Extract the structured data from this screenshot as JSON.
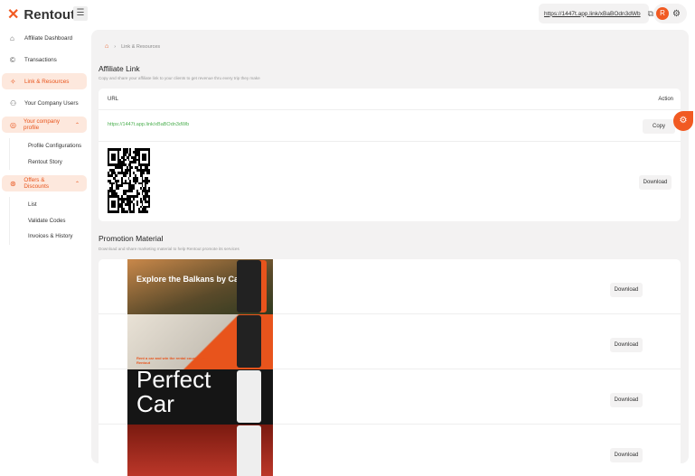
{
  "app": {
    "name": "Rentout",
    "top_link": "https://1447t.app.link/xBaBOdn3dWb",
    "avatar_initial": "R"
  },
  "sidebar": {
    "items": [
      {
        "label": "Affiliate Dashboard",
        "icon": "home-icon"
      },
      {
        "label": "Transactions",
        "icon": "currency-icon"
      },
      {
        "label": "Link & Resources",
        "icon": "sparkle-icon",
        "active": true
      },
      {
        "label": "Your Company Users",
        "icon": "users-icon"
      },
      {
        "label": "Your company profile",
        "icon": "profile-icon",
        "expanded": true,
        "children": [
          "Profile Configurations",
          "Rentout Story"
        ]
      },
      {
        "label": "Offers & Discounts",
        "icon": "discount-icon",
        "expanded": true,
        "children": [
          "List",
          "Validate Codes",
          "Invoices & History"
        ]
      }
    ]
  },
  "breadcrumb": {
    "current": "Link & Resources"
  },
  "affiliate": {
    "title": "Affiliate Link",
    "description": "Copy and share your affiliate link to your clients to get revenue thru every trip they make",
    "col_url": "URL",
    "col_action": "Action",
    "url": "https://1447t.app.link/xBaBOdn3dWb",
    "copy_label": "Copy",
    "download_label": "Download"
  },
  "promotion": {
    "title": "Promotion Material",
    "description": "Download and share marketing material to help Rentout promote its services",
    "items": [
      {
        "caption": "Explore the Balkans by Car",
        "download_label": "Download"
      },
      {
        "caption": "Rent a car and win the rental counter with Rentout",
        "download_label": "Download"
      },
      {
        "caption": "Perfect Car",
        "download_label": "Download"
      },
      {
        "caption": "",
        "download_label": "Download"
      }
    ]
  },
  "colors": {
    "accent": "#f15a22",
    "link": "#4caf50"
  }
}
